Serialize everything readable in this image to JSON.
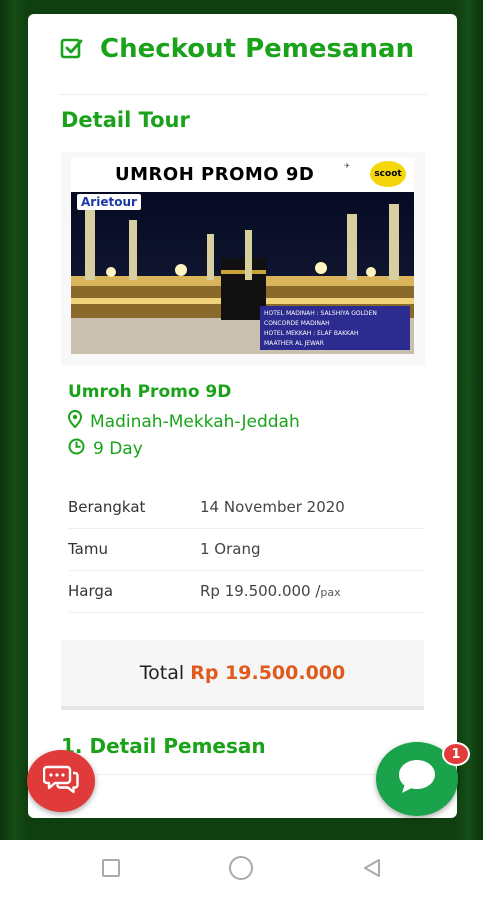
{
  "header": {
    "title": "Checkout Pemesanan",
    "icon": "check-square-icon"
  },
  "detail_tour": {
    "section_title": "Detail Tour",
    "banner": {
      "title": "UMROH PROMO 9D",
      "brand": "Arietour",
      "scoot_logo": "scoot",
      "hotel_lines": [
        "HOTEL MADINAH : SALSHIYA GOLDEN",
        "CONCORDE MADINAH",
        "HOTEL MEKKAH : ELAF BAKKAH",
        "MAATHER AL JEWAR"
      ]
    },
    "tour_name": "Umroh Promo 9D",
    "route": "Madinah-Mekkah-Jeddah",
    "duration": "9 Day"
  },
  "info": {
    "rows": [
      {
        "label": "Berangkat",
        "value": "14 November 2020"
      },
      {
        "label": "Tamu",
        "value": "1 Orang"
      },
      {
        "label": "Harga",
        "value": "Rp 19.500.000 /",
        "unit": "pax"
      }
    ]
  },
  "total": {
    "label": "Total",
    "amount": "Rp 19.500.000"
  },
  "detail_pemesan": {
    "title": "1. Detail Pemesan"
  },
  "chat": {
    "badge_count": "1"
  },
  "colors": {
    "accent_green": "#1aa31a",
    "price_orange": "#e05a1e",
    "chat_red": "#e03a3a",
    "chat_green": "#1aa34a"
  }
}
